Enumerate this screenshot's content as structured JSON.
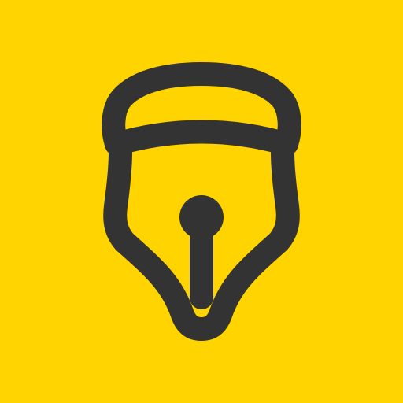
{
  "icon": {
    "name": "fountain-pen-nib-icon",
    "background_color": "#FFD400",
    "foreground_color": "#333333"
  }
}
